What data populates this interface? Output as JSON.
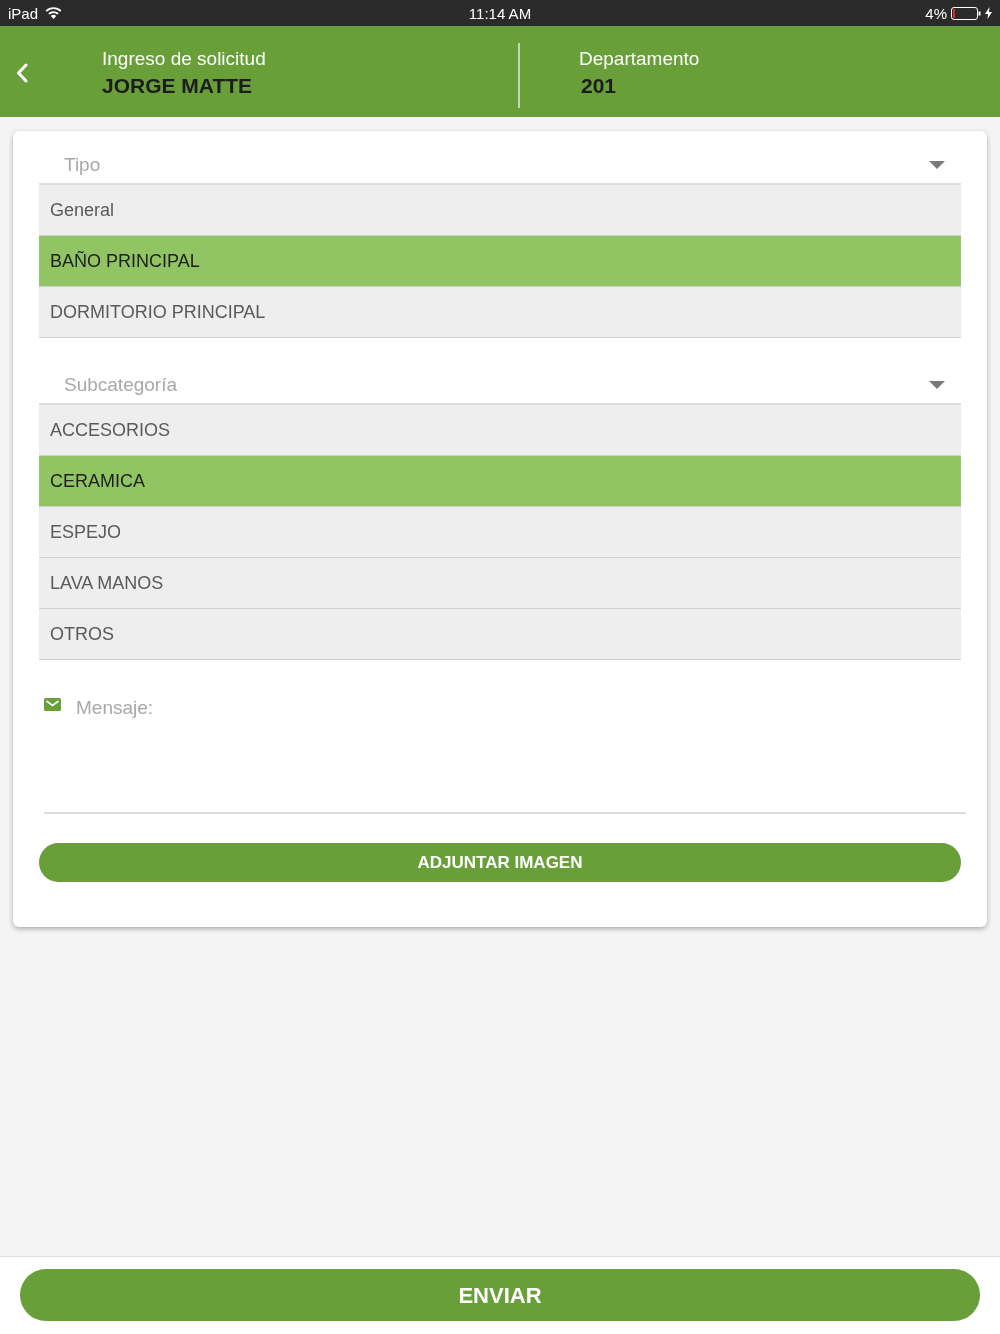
{
  "status_bar": {
    "device": "iPad",
    "time": "11:14 AM",
    "battery": "4%"
  },
  "header": {
    "title": "Ingreso de solicitud",
    "name": "JORGE MATTE",
    "department_label": "Departamento",
    "department": "201"
  },
  "form": {
    "type": {
      "label": "Tipo",
      "options": [
        {
          "label": "General",
          "selected": false
        },
        {
          "label": "BAÑO PRINCIPAL",
          "selected": true
        },
        {
          "label": "DORMITORIO PRINCIPAL",
          "selected": false
        }
      ]
    },
    "subcategory": {
      "label": "Subcategoría",
      "options": [
        {
          "label": "ACCESORIOS",
          "selected": false
        },
        {
          "label": "CERAMICA",
          "selected": true
        },
        {
          "label": "ESPEJO",
          "selected": false
        },
        {
          "label": "LAVA MANOS",
          "selected": false
        },
        {
          "label": "OTROS",
          "selected": false
        }
      ]
    },
    "message": {
      "placeholder": "Mensaje:"
    },
    "attach_button": "ADJUNTAR IMAGEN"
  },
  "submit_button": "ENVIAR"
}
